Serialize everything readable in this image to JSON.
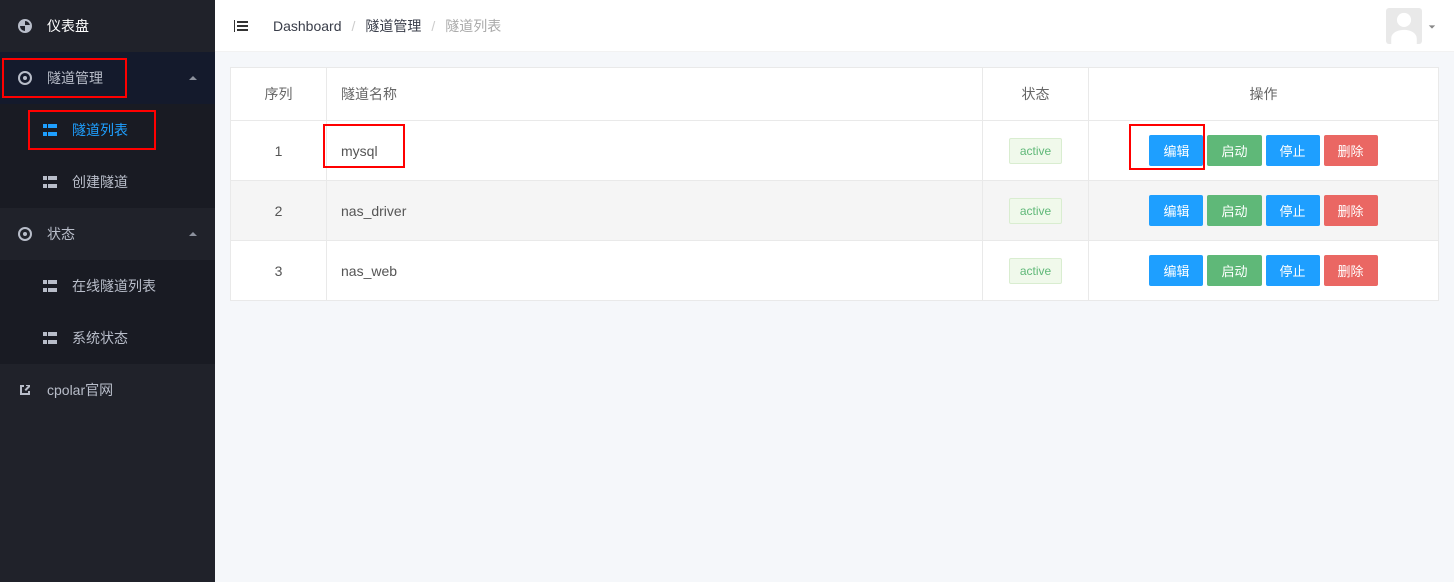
{
  "sidebar": {
    "items": [
      {
        "label": "仪表盘",
        "icon": "dashboard-icon",
        "level": 1
      },
      {
        "label": "隧道管理",
        "icon": "circle-target-icon",
        "level": 1,
        "expandable": true
      },
      {
        "label": "隧道列表",
        "icon": "list-grid-icon",
        "level": 2,
        "active": true
      },
      {
        "label": "创建隧道",
        "icon": "list-grid-icon",
        "level": 2
      },
      {
        "label": "状态",
        "icon": "circle-target-icon",
        "level": 1,
        "expandable": true
      },
      {
        "label": "在线隧道列表",
        "icon": "list-grid-icon",
        "level": 2
      },
      {
        "label": "系统状态",
        "icon": "list-grid-icon",
        "level": 2
      },
      {
        "label": "cpolar官网",
        "icon": "external-link-icon",
        "level": 1
      }
    ]
  },
  "breadcrumbs": {
    "items": [
      {
        "label": "Dashboard",
        "link": true
      },
      {
        "label": "隧道管理",
        "link": true
      },
      {
        "label": "隧道列表",
        "current": true
      }
    ]
  },
  "table": {
    "columns": {
      "seq": "序列",
      "name": "隧道名称",
      "status": "状态",
      "actions": "操作"
    },
    "actions": {
      "edit": "编辑",
      "start": "启动",
      "stop": "停止",
      "delete": "删除"
    },
    "rows": [
      {
        "seq": 1,
        "name": "mysql",
        "status": "active"
      },
      {
        "seq": 2,
        "name": "nas_driver",
        "status": "active"
      },
      {
        "seq": 3,
        "name": "nas_web",
        "status": "active"
      }
    ]
  },
  "annotations": {
    "highlight_sidebar_group": "隧道管理",
    "highlight_sidebar_item": "隧道列表",
    "highlight_row_name": "mysql",
    "highlight_row_action": "编辑"
  }
}
